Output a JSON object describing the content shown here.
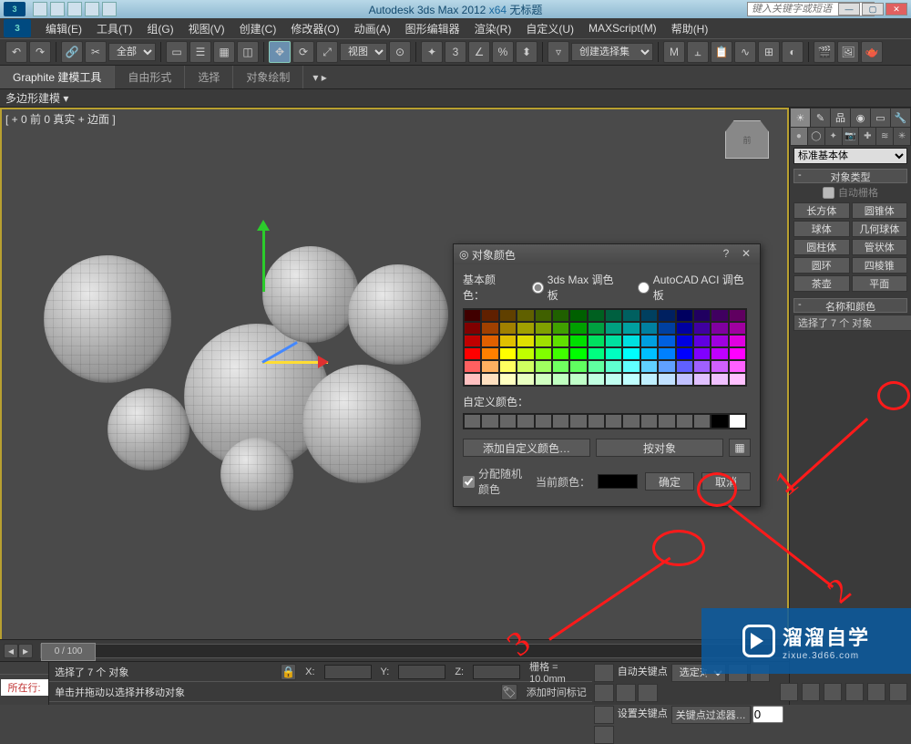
{
  "titlebar": {
    "title_prefix": "Autodesk 3ds Max  2012 ",
    "title_arch": "x64",
    "title_suffix": "     无标题",
    "search_placeholder": "键入关键字或短语"
  },
  "menus": [
    "编辑(E)",
    "工具(T)",
    "组(G)",
    "视图(V)",
    "创建(C)",
    "修改器(O)",
    "动画(A)",
    "图形编辑器",
    "渲染(R)",
    "自定义(U)",
    "MAXScript(M)",
    "帮助(H)"
  ],
  "toolbar": {
    "all_label": "全部",
    "view_label": "视图",
    "create_sel_label": "创建选择集"
  },
  "ribbon": {
    "tabs": [
      "Graphite 建模工具",
      "自由形式",
      "选择",
      "对象绘制"
    ],
    "sub": "多边形建模",
    "vp_label": "[ + 0 前 0 真实 + 边面 ]"
  },
  "panel": {
    "dropdown": "标准基本体",
    "rollout_objtype": "对象类型",
    "autogrid": "自动栅格",
    "geo": [
      "长方体",
      "圆锥体",
      "球体",
      "几何球体",
      "圆柱体",
      "管状体",
      "圆环",
      "四棱锥",
      "茶壶",
      "平面"
    ],
    "rollout_name": "名称和颜色",
    "name_value": "选择了 7 个 对象"
  },
  "dialog": {
    "title": "对象颜色",
    "basic_label": "基本颜色：",
    "opt_3dsmax": "3ds Max 调色板",
    "opt_acad": "AutoCAD ACI 调色板",
    "custom_label": "自定义颜色：",
    "add_custom": "添加自定义颜色…",
    "by_object": "按对象",
    "assign_random": "分配随机颜色",
    "current_color": "当前颜色：",
    "ok": "确定",
    "cancel": "取消"
  },
  "palette_colors": [
    "#400000",
    "#602000",
    "#604000",
    "#606000",
    "#406000",
    "#206000",
    "#006000",
    "#006020",
    "#006040",
    "#006060",
    "#004060",
    "#002060",
    "#000060",
    "#200060",
    "#400060",
    "#600060",
    "#800000",
    "#a04000",
    "#a08000",
    "#a0a000",
    "#80a000",
    "#40a000",
    "#00a000",
    "#00a040",
    "#00a080",
    "#00a0a0",
    "#0080a0",
    "#0040a0",
    "#0000a0",
    "#4000a0",
    "#8000a0",
    "#a000a0",
    "#c00000",
    "#e06000",
    "#e0c000",
    "#e0e000",
    "#a0e000",
    "#60e000",
    "#00e000",
    "#00e060",
    "#00e0a0",
    "#00e0e0",
    "#00a0e0",
    "#0060e0",
    "#0000e0",
    "#6000e0",
    "#a000e0",
    "#e000e0",
    "#ff0000",
    "#ff8000",
    "#ffff00",
    "#c0ff00",
    "#80ff00",
    "#40ff00",
    "#00ff00",
    "#00ff80",
    "#00ffc0",
    "#00ffff",
    "#00c0ff",
    "#0080ff",
    "#0000ff",
    "#8000ff",
    "#c000ff",
    "#ff00ff",
    "#ff6060",
    "#ffb060",
    "#ffff60",
    "#d0ff60",
    "#a0ff60",
    "#70ff60",
    "#60ff60",
    "#60ffa0",
    "#60ffd0",
    "#60ffff",
    "#60d0ff",
    "#60a0ff",
    "#6060ff",
    "#a060ff",
    "#d060ff",
    "#ff60ff",
    "#ffc0c0",
    "#ffe0c0",
    "#ffffc0",
    "#e8ffc0",
    "#d0ffc0",
    "#c0ffc0",
    "#c0ffc8",
    "#c0ffe0",
    "#c0fff0",
    "#c0ffff",
    "#c0f0ff",
    "#c0e0ff",
    "#c0c0ff",
    "#e0c0ff",
    "#f0c0ff",
    "#ffc0ff"
  ],
  "status": {
    "sel_info": "选择了 7 个 对象",
    "hint": "单击并拖动以选择并移动对象",
    "add_time": "添加时间标记",
    "grid_label": "栅格 = 10.0mm",
    "autokey": "自动关键点",
    "setkey": "设置关键点",
    "selected_filter": "选定对象",
    "keyfilter": "关键点过滤器…",
    "x": "X:",
    "y": "Y:",
    "z": "Z:",
    "now_btn": "所在行:",
    "timeline": "0 / 100"
  },
  "watermark": {
    "big": "溜溜自学",
    "small": "zixue.3d66.com"
  },
  "anno": {
    "n1": "1",
    "n2": "2",
    "n3": "3"
  }
}
